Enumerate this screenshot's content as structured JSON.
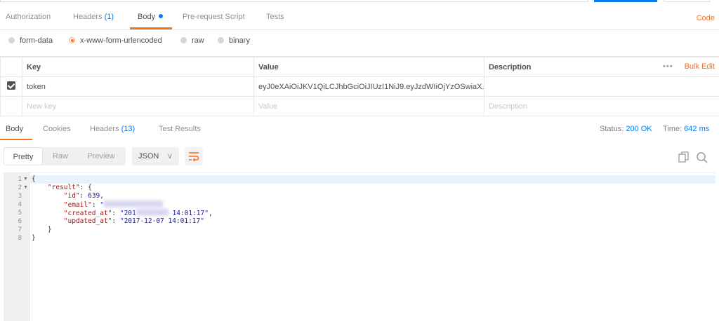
{
  "request_tabs": [
    {
      "label": "Authorization"
    },
    {
      "label": "Headers",
      "count": "(1)"
    },
    {
      "label": "Body"
    },
    {
      "label": "Pre-request Script"
    },
    {
      "label": "Tests"
    }
  ],
  "code_link": "Code",
  "body_types": [
    "form-data",
    "x-www-form-urlencoded",
    "raw",
    "binary"
  ],
  "kv_table": {
    "headers": {
      "key": "Key",
      "value": "Value",
      "description": "Description"
    },
    "bulk_edit": "Bulk Edit",
    "more": "•••",
    "row": {
      "key": "token",
      "value": "eyJ0eXAiOiJKV1QiLCJhbGciOiJIUzI1NiJ9.eyJzdWIiOjYzOSwiaX..."
    },
    "placeholders": {
      "key": "New key",
      "value": "Value",
      "description": "Description"
    }
  },
  "response_tabs": [
    {
      "label": "Body"
    },
    {
      "label": "Cookies"
    },
    {
      "label": "Headers",
      "count": "(13)"
    },
    {
      "label": "Test Results"
    }
  ],
  "status": {
    "status_label": "Status:",
    "status_value": "200 OK",
    "time_label": "Time:",
    "time_value": "642 ms"
  },
  "view_modes": [
    "Pretty",
    "Raw",
    "Preview"
  ],
  "format": "JSON",
  "editor": {
    "line_numbers": [
      "1",
      "2",
      "3",
      "4",
      "5",
      "6",
      "7",
      "8"
    ],
    "lines": {
      "l1": "{",
      "l2_key": "\"result\"",
      "l2_rest": ": {",
      "l3_key": "\"id\"",
      "l3_sep": ": ",
      "l3_val": "639",
      "l3_end": ",",
      "l4_key": "\"email\"",
      "l4_sep": ": ",
      "l4_val": "\"",
      "l5_key": "\"created_at\"",
      "l5_sep": ": ",
      "l5_val_a": "\"201",
      "l5_val_b": " 14:01:17\"",
      "l5_end": ",",
      "l6_key": "\"updated_at\"",
      "l6_sep": ": ",
      "l6_val": "\"2017-12-07 14:01:17\"",
      "l7": "}",
      "l8": "}"
    }
  }
}
